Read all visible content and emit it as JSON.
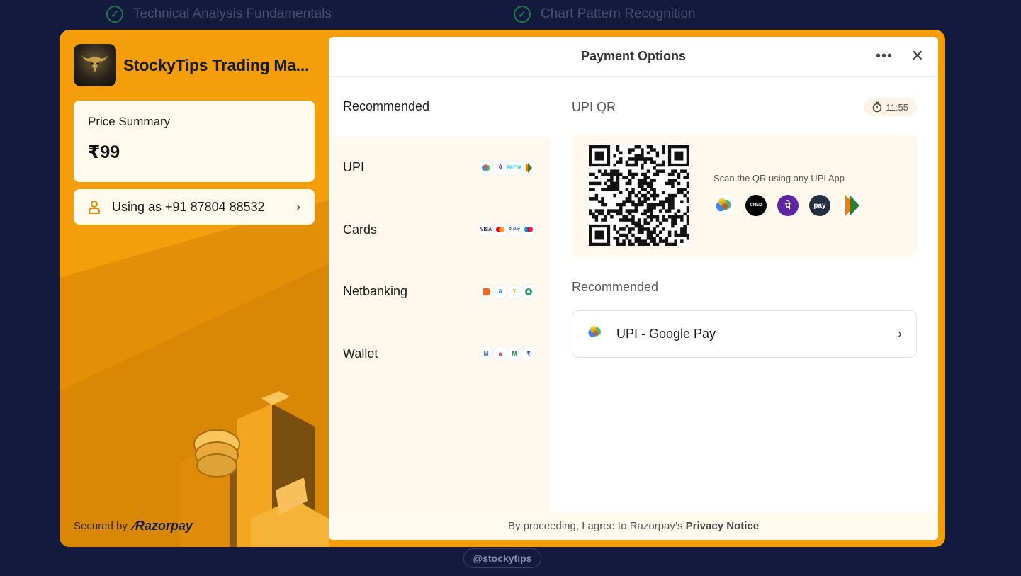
{
  "background": {
    "features": [
      "Technical Analysis Fundamentals",
      "Chart Pattern Recognition"
    ],
    "handle": "@stockytips"
  },
  "merchant": {
    "name": "StockyTips Trading Ma...",
    "price_label": "Price Summary",
    "price": "₹99",
    "user_text": "Using as +91 87804 88532",
    "secured_by": "Secured by",
    "provider": "Razorpay"
  },
  "panel": {
    "title": "Payment Options",
    "methods_heading": "Recommended",
    "methods": [
      {
        "label": "UPI"
      },
      {
        "label": "Cards"
      },
      {
        "label": "Netbanking"
      },
      {
        "label": "Wallet"
      }
    ],
    "upi": {
      "title": "UPI QR",
      "timer": "11:55",
      "scan_text": "Scan the QR using any UPI App",
      "apps": [
        "google-pay-icon",
        "cred-icon",
        "phonepe-icon",
        "amazon-pay-icon",
        "bhim-icon"
      ]
    },
    "recommended": {
      "heading": "Recommended",
      "item_label": "UPI - Google Pay"
    },
    "footer_prefix": "By proceeding, I agree to Razorpay’s",
    "footer_link": "Privacy Notice"
  },
  "colors": {
    "accent": "#f59e0b",
    "page_bg": "#141a3d"
  }
}
